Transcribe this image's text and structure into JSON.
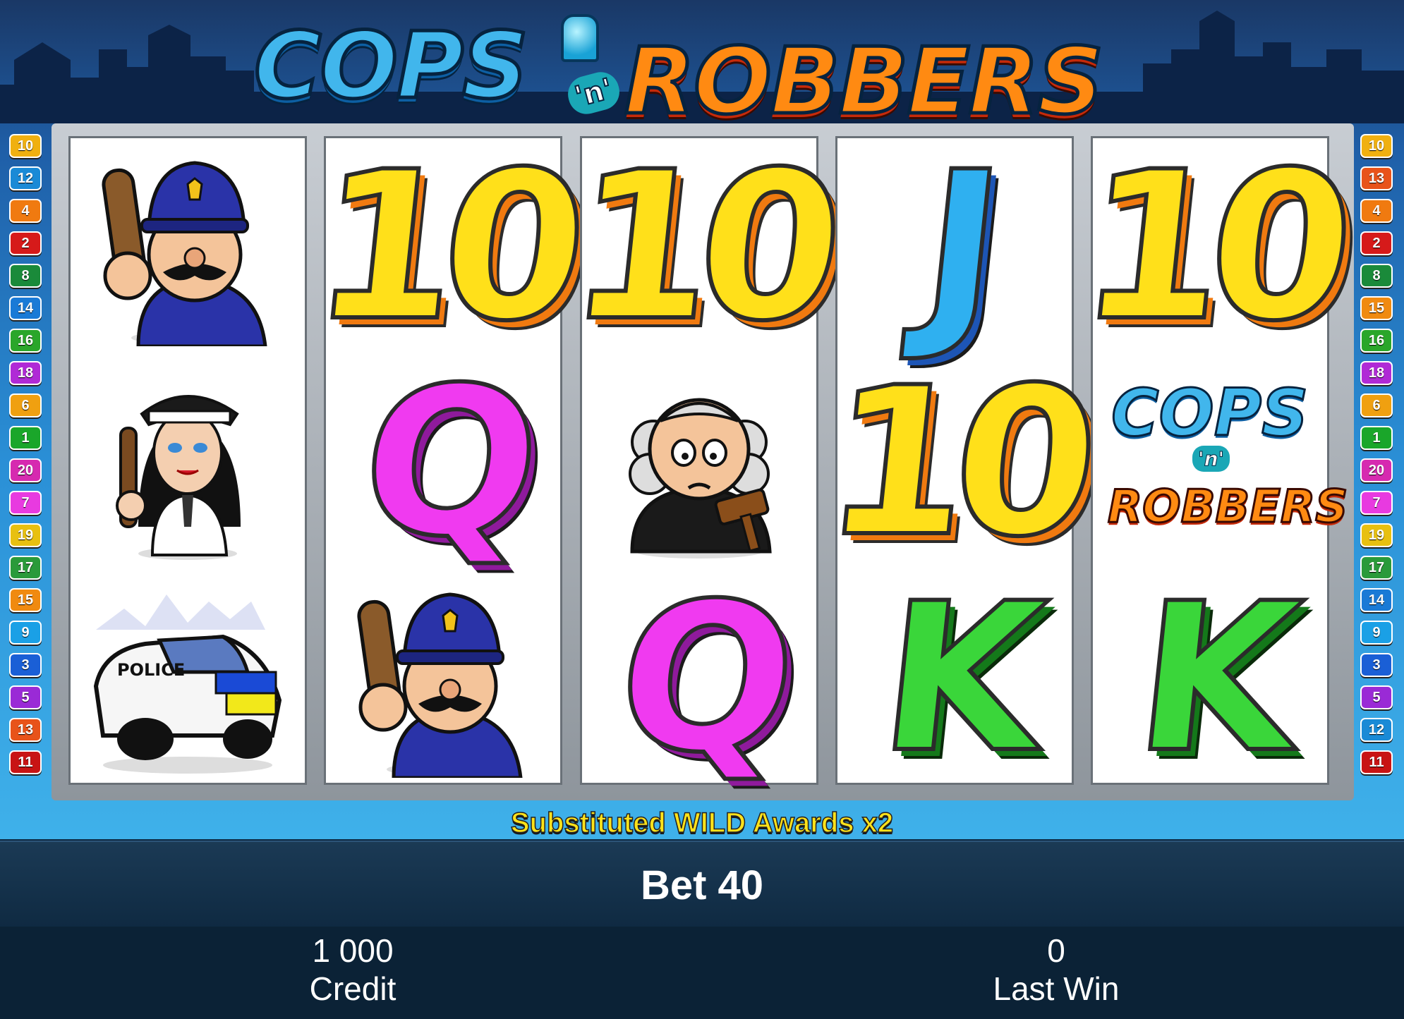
{
  "game": {
    "logo_left": "COPS",
    "logo_mid": "'n'",
    "logo_right": "ROBBERS"
  },
  "paylines_left": [
    "10",
    "12",
    "4",
    "2",
    "8",
    "14",
    "16",
    "18",
    "6",
    "1",
    "20",
    "7",
    "19",
    "17",
    "15",
    "9",
    "3",
    "5",
    "13",
    "11"
  ],
  "paylines_right": [
    "10",
    "13",
    "4",
    "2",
    "8",
    "15",
    "16",
    "18",
    "6",
    "1",
    "20",
    "7",
    "19",
    "17",
    "14",
    "9",
    "3",
    "5",
    "12",
    "11"
  ],
  "payline_colors": {
    "1": "#1aa62a",
    "2": "#d61a1a",
    "3": "#1a5fd6",
    "4": "#f07a10",
    "5": "#9a2ad6",
    "6": "#f0a010",
    "7": "#e83ae0",
    "8": "#1a8a3a",
    "9": "#1aa0e6",
    "10": "#f0b010",
    "11": "#c81414",
    "12": "#1a8ad6",
    "13": "#e8531a",
    "14": "#1a7ad6",
    "15": "#f08a10",
    "16": "#2aa62a",
    "17": "#2a9a3a",
    "18": "#b02ad6",
    "19": "#e8c010",
    "20": "#d62ab0"
  },
  "reels": [
    [
      "policeman-symbol",
      "policewoman-symbol",
      "police-car-symbol"
    ],
    [
      "10",
      "Q",
      "policeman-symbol"
    ],
    [
      "10",
      "judge-symbol",
      "Q"
    ],
    [
      "J",
      "10",
      "K"
    ],
    [
      "10",
      "wild-logo-symbol",
      "K"
    ]
  ],
  "car_label": "POLICE",
  "wild_logo": {
    "top": "COPS",
    "mid": "'n'",
    "bottom": "ROBBERS"
  },
  "message": "Substituted WILD Awards x2",
  "bet": {
    "text": "Bet 40"
  },
  "credit": {
    "value": "1 000",
    "label": "Credit"
  },
  "last_win": {
    "value": "0",
    "label": "Last Win"
  }
}
